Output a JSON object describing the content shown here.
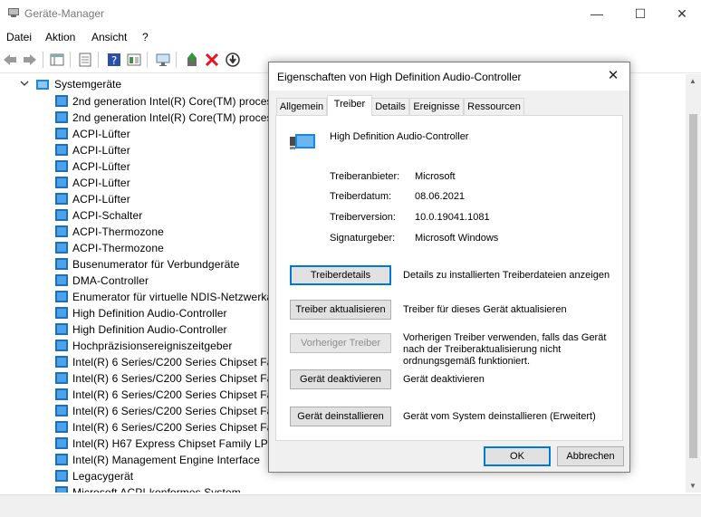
{
  "window": {
    "title": "Geräte-Manager",
    "minimize": "—",
    "maximize": "☐",
    "close": "✕"
  },
  "menu": [
    "Datei",
    "Aktion",
    "Ansicht",
    "?"
  ],
  "tree": {
    "root": "Systemgeräte",
    "items": [
      "2nd generation Intel(R) Core(TM) processor",
      "2nd generation Intel(R) Core(TM) processor",
      "ACPI-Lüfter",
      "ACPI-Lüfter",
      "ACPI-Lüfter",
      "ACPI-Lüfter",
      "ACPI-Lüfter",
      "ACPI-Schalter",
      "ACPI-Thermozone",
      "ACPI-Thermozone",
      "Busenumerator für Verbundgeräte",
      "DMA-Controller",
      "Enumerator für virtuelle NDIS-Netzwerkadapter",
      "High Definition Audio-Controller",
      "High Definition Audio-Controller",
      "Hochpräzisionsereigniszeitgeber",
      "Intel(R) 6 Series/C200 Series Chipset Family",
      "Intel(R) 6 Series/C200 Series Chipset Family",
      "Intel(R) 6 Series/C200 Series Chipset Family",
      "Intel(R) 6 Series/C200 Series Chipset Family",
      "Intel(R) 6 Series/C200 Series Chipset Family",
      "Intel(R) H67 Express Chipset Family LPC Interface",
      "Intel(R) Management Engine Interface",
      "Legacygerät",
      "Microsoft ACPI-konformes System"
    ]
  },
  "dialog": {
    "title": "Eigenschaften von High Definition Audio-Controller",
    "close": "✕",
    "tabs": [
      "Allgemein",
      "Treiber",
      "Details",
      "Ereignisse",
      "Ressourcen"
    ],
    "active_tab": "Treiber",
    "device_name": "High Definition Audio-Controller",
    "info": [
      {
        "label": "Treiberanbieter:",
        "value": "Microsoft"
      },
      {
        "label": "Treiberdatum:",
        "value": "08.06.2021"
      },
      {
        "label": "Treiberversion:",
        "value": "10.0.19041.1081"
      },
      {
        "label": "Signaturgeber:",
        "value": "Microsoft Windows"
      }
    ],
    "actions": [
      {
        "button": "Treiberdetails",
        "desc": "Details zu installierten Treiberdateien anzeigen",
        "enabled": true
      },
      {
        "button": "Treiber aktualisieren",
        "desc": "Treiber für dieses Gerät aktualisieren",
        "enabled": true
      },
      {
        "button": "Vorheriger Treiber",
        "desc": "Vorherigen Treiber verwenden, falls das Gerät nach der Treiberaktualisierung nicht ordnungsgemäß funktioniert.",
        "enabled": false
      },
      {
        "button": "Gerät deaktivieren",
        "desc": "Gerät deaktivieren",
        "enabled": true
      },
      {
        "button": "Gerät deinstallieren",
        "desc": "Gerät vom System deinstallieren (Erweitert)",
        "enabled": true
      }
    ],
    "ok": "OK",
    "cancel": "Abbrechen"
  },
  "colors": {
    "accent": "#0078d7",
    "delete_red": "#e81123",
    "device_blue": "#1e88d8"
  }
}
